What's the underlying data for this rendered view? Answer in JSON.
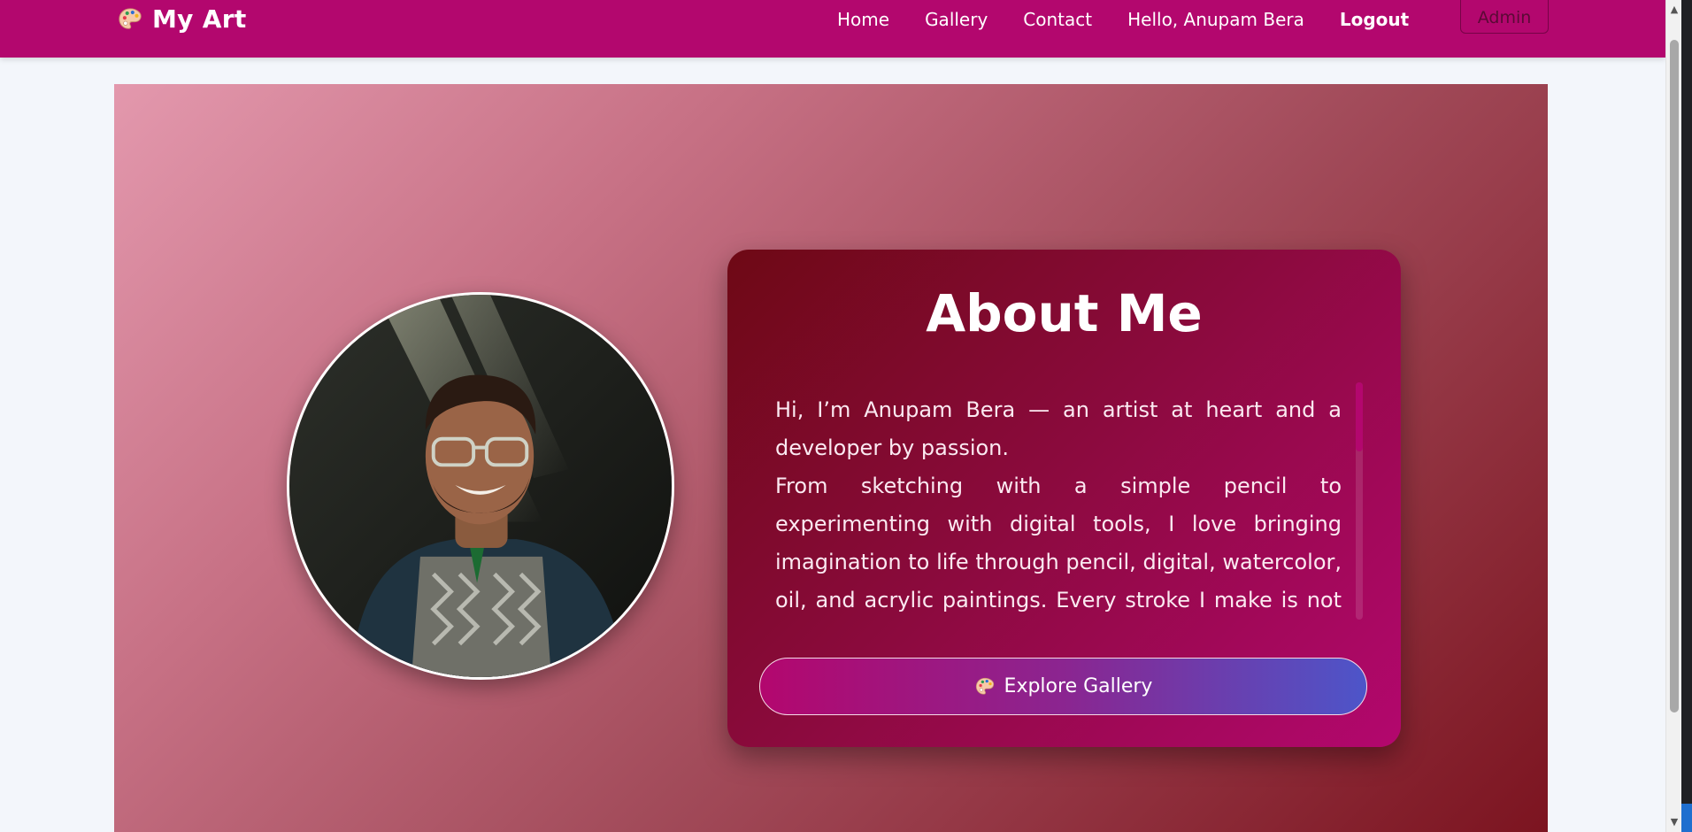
{
  "navbar": {
    "brand_icon": "palette-icon",
    "brand": "My Art",
    "links": {
      "home": "Home",
      "gallery": "Gallery",
      "contact": "Contact",
      "greeting": "Hello, Anupam Bera",
      "logout": "Logout"
    },
    "admin": "Admin",
    "background_color": "#b3076e"
  },
  "hero": {
    "portrait_icon": "profile-photo",
    "about": {
      "title": "About Me",
      "paragraph_1": "Hi, I’m Anupam Bera — an artist at heart and a developer by passion.",
      "paragraph_2": "From sketching with a simple pencil to experimenting with digital tools, I love bringing imagination to life through pencil, digital, watercolor, oil, and acrylic paintings. Every stroke I make is not just about colors",
      "button_icon": "palette-icon",
      "button": "Explore Gallery"
    }
  },
  "scrollbar": {
    "up_icon": "scroll-up-arrow-icon",
    "down_icon": "scroll-down-arrow-icon"
  }
}
